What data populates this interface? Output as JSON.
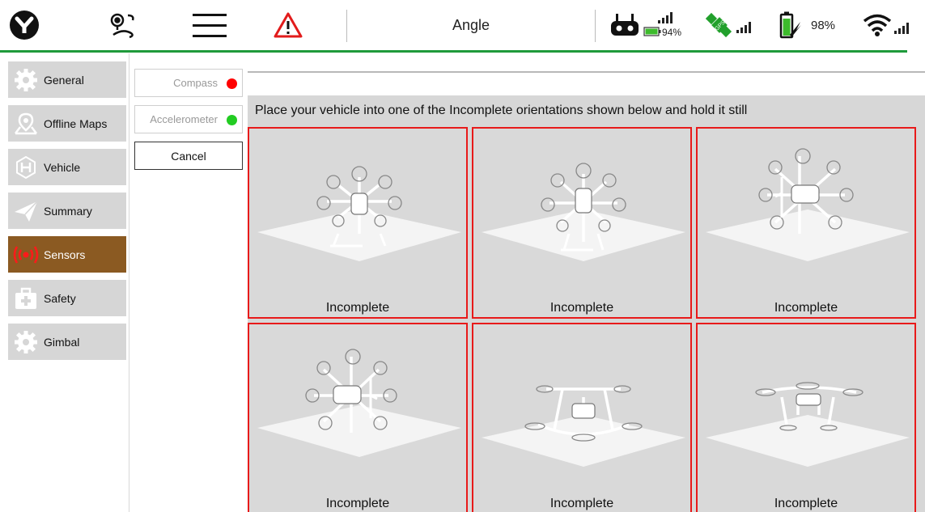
{
  "toolbar": {
    "flight_mode": "Angle",
    "remote_battery": "94%",
    "vehicle_battery": "98%",
    "gps_badge": "GPS",
    "icons": [
      "app-logo-icon",
      "plan-route-icon",
      "menu-icon",
      "warning-icon",
      "remote-controller-icon",
      "gps-satellite-icon",
      "battery-icon",
      "wifi-icon"
    ]
  },
  "sidebar": {
    "items": [
      {
        "label": "General",
        "icon": "gear-icon",
        "active": false
      },
      {
        "label": "Offline Maps",
        "icon": "map-icon",
        "active": false
      },
      {
        "label": "Vehicle",
        "icon": "vehicle-icon",
        "active": false
      },
      {
        "label": "Summary",
        "icon": "paper-plane-icon",
        "active": false
      },
      {
        "label": "Sensors",
        "icon": "sensors-icon",
        "active": true
      },
      {
        "label": "Safety",
        "icon": "first-aid-icon",
        "active": false
      },
      {
        "label": "Gimbal",
        "icon": "gear-icon",
        "active": false
      }
    ]
  },
  "calibration": {
    "compass_label": "Compass",
    "compass_status_color": "#ff0000",
    "accelerometer_label": "Accelerometer",
    "accelerometer_status_color": "#22cc22",
    "cancel_label": "Cancel"
  },
  "main": {
    "instructions": "Place your vehicle into one of the Incomplete orientations shown below and hold it still",
    "tiles": [
      {
        "status": "Incomplete",
        "orientation": "nose-down"
      },
      {
        "status": "Incomplete",
        "orientation": "nose-up"
      },
      {
        "status": "Incomplete",
        "orientation": "left-side"
      },
      {
        "status": "Incomplete",
        "orientation": "right-side"
      },
      {
        "status": "Incomplete",
        "orientation": "upside-down"
      },
      {
        "status": "Incomplete",
        "orientation": "level"
      }
    ]
  },
  "colors": {
    "accent_green": "#1f9a3b",
    "active_nav": "#8b5a22",
    "incomplete_border": "#e81a1a"
  }
}
